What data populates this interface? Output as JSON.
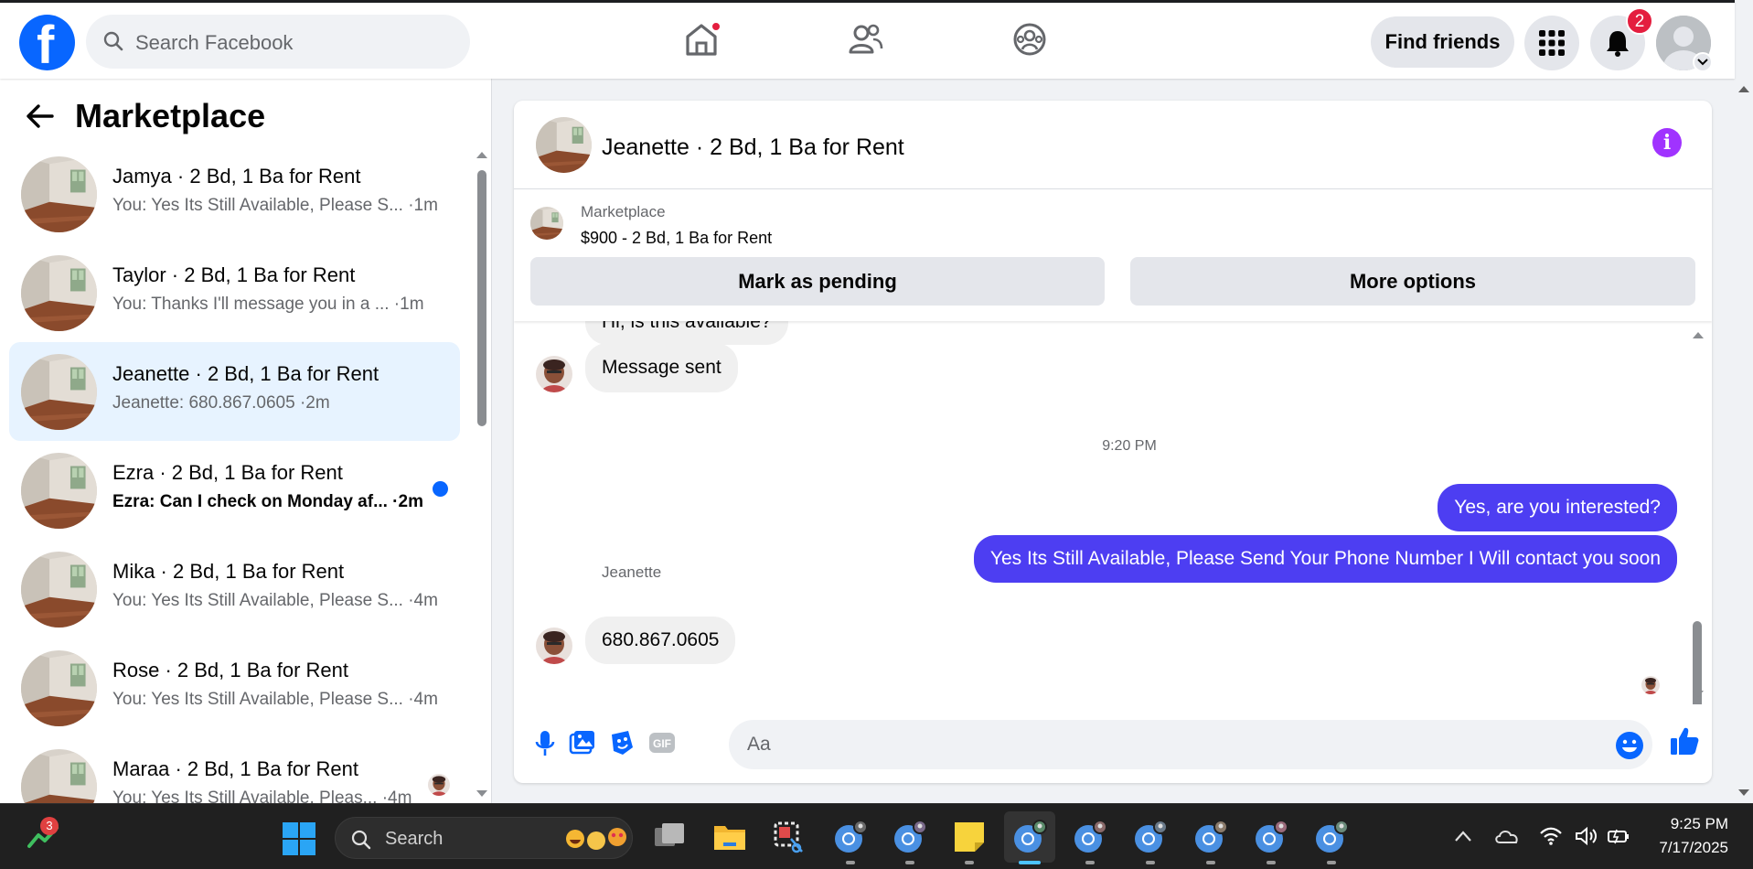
{
  "nav": {
    "search_placeholder": "Search Facebook",
    "find_friends": "Find friends",
    "notification_count": "2",
    "home_has_dot": true
  },
  "sidebar": {
    "title": "Marketplace",
    "conversations": [
      {
        "title": "Jamya · 2 Bd, 1 Ba for Rent",
        "preview": "You: Yes Its Still Available, Please S... ·1m",
        "unread": false,
        "active": false
      },
      {
        "title": "Taylor · 2 Bd, 1 Ba for Rent",
        "preview": "You: Thanks I'll message you in a ... ·1m",
        "unread": false,
        "active": false
      },
      {
        "title": "Jeanette · 2 Bd, 1 Ba for Rent",
        "preview": "Jeanette: 680.867.0605 ·2m",
        "unread": false,
        "active": true
      },
      {
        "title": "Ezra · 2 Bd, 1 Ba for Rent",
        "preview": "Ezra: Can I check on Monday af... ·2m",
        "unread": true,
        "active": false
      },
      {
        "title": "Mika · 2 Bd, 1 Ba for Rent",
        "preview": "You: Yes Its Still Available, Please S... ·4m",
        "unread": false,
        "active": false
      },
      {
        "title": "Rose · 2 Bd, 1 Ba for Rent",
        "preview": "You: Yes Its Still Available, Please S... ·4m",
        "unread": false,
        "active": false
      },
      {
        "title": "Maraa · 2 Bd, 1 Ba for Rent",
        "preview": "You: Yes Its Still Available, Pleas... ·4m",
        "unread": false,
        "active": false
      }
    ]
  },
  "chat": {
    "title": "Jeanette · 2 Bd, 1 Ba for Rent",
    "listing": {
      "source": "Marketplace",
      "name": "$900 - 2 Bd, 1 Ba for Rent",
      "mark_pending": "Mark as pending",
      "more_options": "More options"
    },
    "messages": {
      "partial_in": "Hi, is this available?",
      "sent_notice": "Message sent",
      "timestamp": "9:20 PM",
      "out_1": "Yes, are you interested?",
      "out_2": "Yes Its Still Available, Please Send Your Phone Number I Will contact you soon",
      "sender": "Jeanette",
      "in_reply": "680.867.0605"
    },
    "composer_placeholder": "Aa"
  },
  "taskbar": {
    "search_label": "Search",
    "stock_badge": "3",
    "time": "9:25 PM",
    "date": "7/17/2025"
  },
  "colors": {
    "fb_blue": "#0866ff",
    "outgoing_bubble": "#4d3ef2",
    "info_purple": "#a033ff",
    "notif_red": "#e41e3f"
  }
}
